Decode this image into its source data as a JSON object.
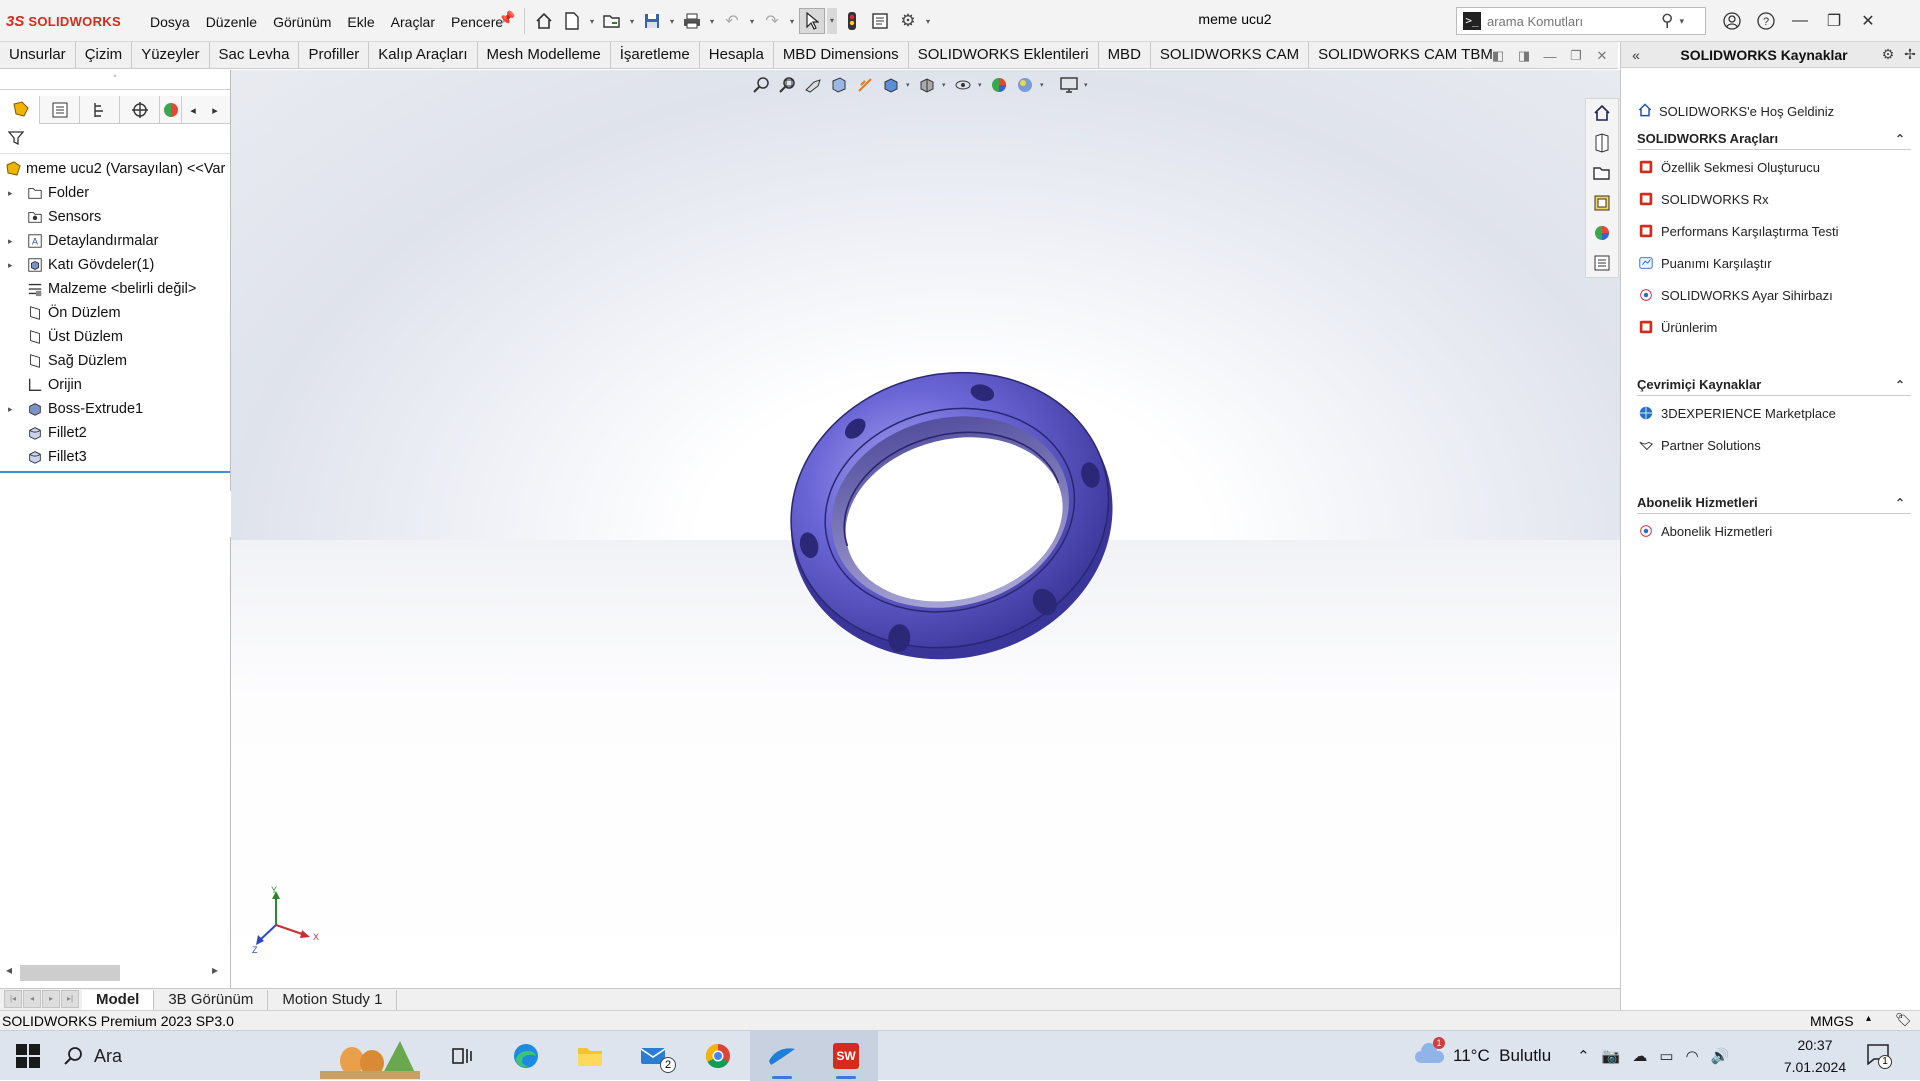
{
  "app": {
    "brand": "SOLIDWORKS",
    "document_title": "meme ucu2"
  },
  "menu_bar": [
    "Dosya",
    "Düzenle",
    "Görünüm",
    "Ekle",
    "Araçlar",
    "Pencere"
  ],
  "search": {
    "placeholder": "arama Komutları"
  },
  "command_tabs": [
    "Unsurlar",
    "Çizim",
    "Yüzeyler",
    "Sac Levha",
    "Profiller",
    "Kalıp Araçları",
    "Mesh Modelleme",
    "İşaretleme",
    "Hesapla",
    "MBD Dimensions",
    "SOLIDWORKS Eklentileri",
    "MBD",
    "SOLIDWORKS CAM",
    "SOLIDWORKS CAM TBM"
  ],
  "feature_tree": {
    "root": "meme ucu2 (Varsayılan) <<Var",
    "items": [
      {
        "label": "Folder",
        "icon": "folder-icon",
        "expandable": true
      },
      {
        "label": "Sensors",
        "icon": "sensor-icon",
        "expandable": false
      },
      {
        "label": "Detaylandırmalar",
        "icon": "annotation-icon",
        "expandable": true
      },
      {
        "label": "Katı Gövdeler(1)",
        "icon": "solid-bodies-icon",
        "expandable": true
      },
      {
        "label": "Malzeme <belirli değil>",
        "icon": "material-icon",
        "expandable": false
      },
      {
        "label": "Ön Düzlem",
        "icon": "plane-icon",
        "expandable": false
      },
      {
        "label": "Üst Düzlem",
        "icon": "plane-icon",
        "expandable": false
      },
      {
        "label": "Sağ Düzlem",
        "icon": "plane-icon",
        "expandable": false
      },
      {
        "label": "Orijin",
        "icon": "origin-icon",
        "expandable": false
      },
      {
        "label": "Boss-Extrude1",
        "icon": "extrude-icon",
        "expandable": true
      },
      {
        "label": "Fillet2",
        "icon": "fillet-icon",
        "expandable": false
      },
      {
        "label": "Fillet3",
        "icon": "fillet-icon",
        "expandable": false
      }
    ]
  },
  "triad": {
    "x": "X",
    "y": "Y",
    "z": "Z"
  },
  "bottom_tabs": [
    "Model",
    "3B Görünüm",
    "Motion Study 1"
  ],
  "active_bottom_tab": "Model",
  "task_pane": {
    "title": "SOLIDWORKS Kaynaklar",
    "welcome": "SOLIDWORKS'e Hoş Geldiniz",
    "sections": [
      {
        "title": "SOLIDWORKS Araçları",
        "items": [
          "Özellik Sekmesi Oluşturucu",
          "SOLIDWORKS Rx",
          "Performans Karşılaştırma Testi",
          "Puanımı Karşılaştır",
          "SOLIDWORKS Ayar Sihirbazı",
          "Ürünlerim"
        ]
      },
      {
        "title": "Çevrimiçi Kaynaklar",
        "items": [
          "3DEXPERIENCE Marketplace",
          "Partner Solutions"
        ]
      },
      {
        "title": "Abonelik Hizmetleri",
        "items": [
          "Abonelik Hizmetleri"
        ]
      }
    ]
  },
  "status_bar": {
    "version": "SOLIDWORKS Premium 2023 SP3.0",
    "units": "MMGS"
  },
  "taskbar": {
    "search_label": "Ara",
    "mail_badge": "2",
    "weather_badge": "1",
    "weather": "11°C  Bulutlu",
    "time": "20:37",
    "date": "7.01.2024",
    "notification_count": "1"
  },
  "colors": {
    "part_fill": "#6b66d6",
    "part_dark": "#3a3598",
    "brand_red": "#d52b1e",
    "active_underline": "#3b7ad8"
  }
}
